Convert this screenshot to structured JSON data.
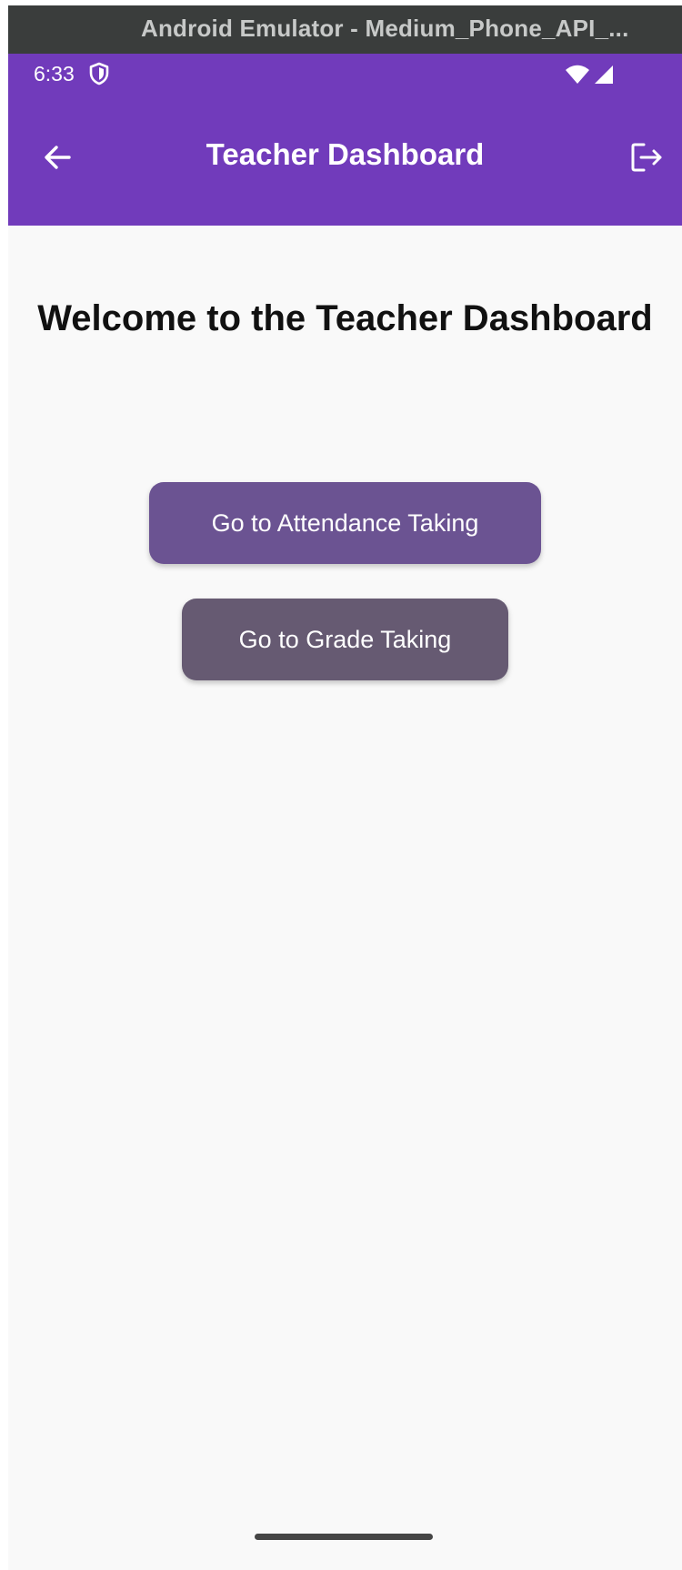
{
  "emulator": {
    "title": "Android Emulator - Medium_Phone_API_..."
  },
  "status_bar": {
    "time": "6:33",
    "icons": [
      "shield-icon",
      "wifi-icon",
      "signal-icon"
    ]
  },
  "app_bar": {
    "title": "Teacher Dashboard",
    "background_color": "#713bbb",
    "leading_icon": "arrow-back-icon",
    "trailing_icon": "logout-icon"
  },
  "main": {
    "heading": "Welcome to the Teacher Dashboard",
    "buttons": [
      {
        "label": "Go to Attendance Taking",
        "color": "#6b5392"
      },
      {
        "label": "Go to Grade Taking",
        "color": "#665a72"
      }
    ]
  }
}
